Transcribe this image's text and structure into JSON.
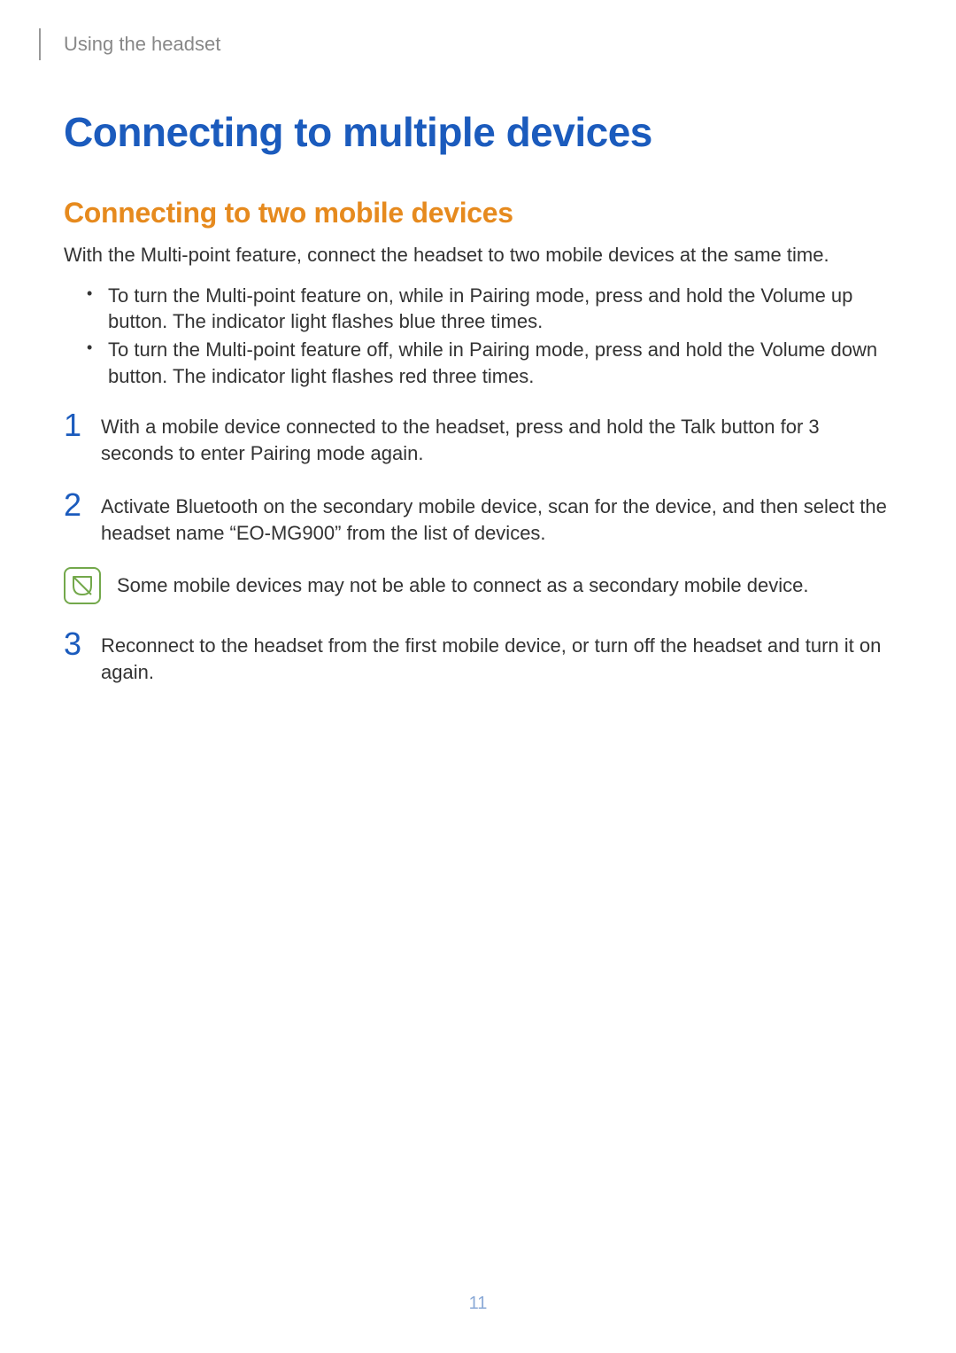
{
  "header": {
    "section": "Using the headset"
  },
  "title": "Connecting to multiple devices",
  "subtitle": "Connecting to two mobile devices",
  "intro": "With the Multi-point feature, connect the headset to two mobile devices at the same time.",
  "bullets": [
    "To turn the Multi-point feature on, while in Pairing mode, press and hold the Volume up button. The indicator light flashes blue three times.",
    "To turn the Multi-point feature off, while in Pairing mode, press and hold the Volume down button. The indicator light flashes red three times."
  ],
  "steps": [
    {
      "num": "1",
      "text": "With a mobile device connected to the headset, press and hold the Talk button for 3 seconds to enter Pairing mode again."
    },
    {
      "num": "2",
      "text": "Activate Bluetooth on the secondary mobile device, scan for the device, and then select the headset name “EO-MG900” from the list of devices."
    },
    {
      "num": "3",
      "text": "Reconnect to the headset from the first mobile device, or turn off the headset and turn it on again."
    }
  ],
  "note": "Some mobile devices may not be able to connect as a secondary mobile device.",
  "page_number": "11"
}
